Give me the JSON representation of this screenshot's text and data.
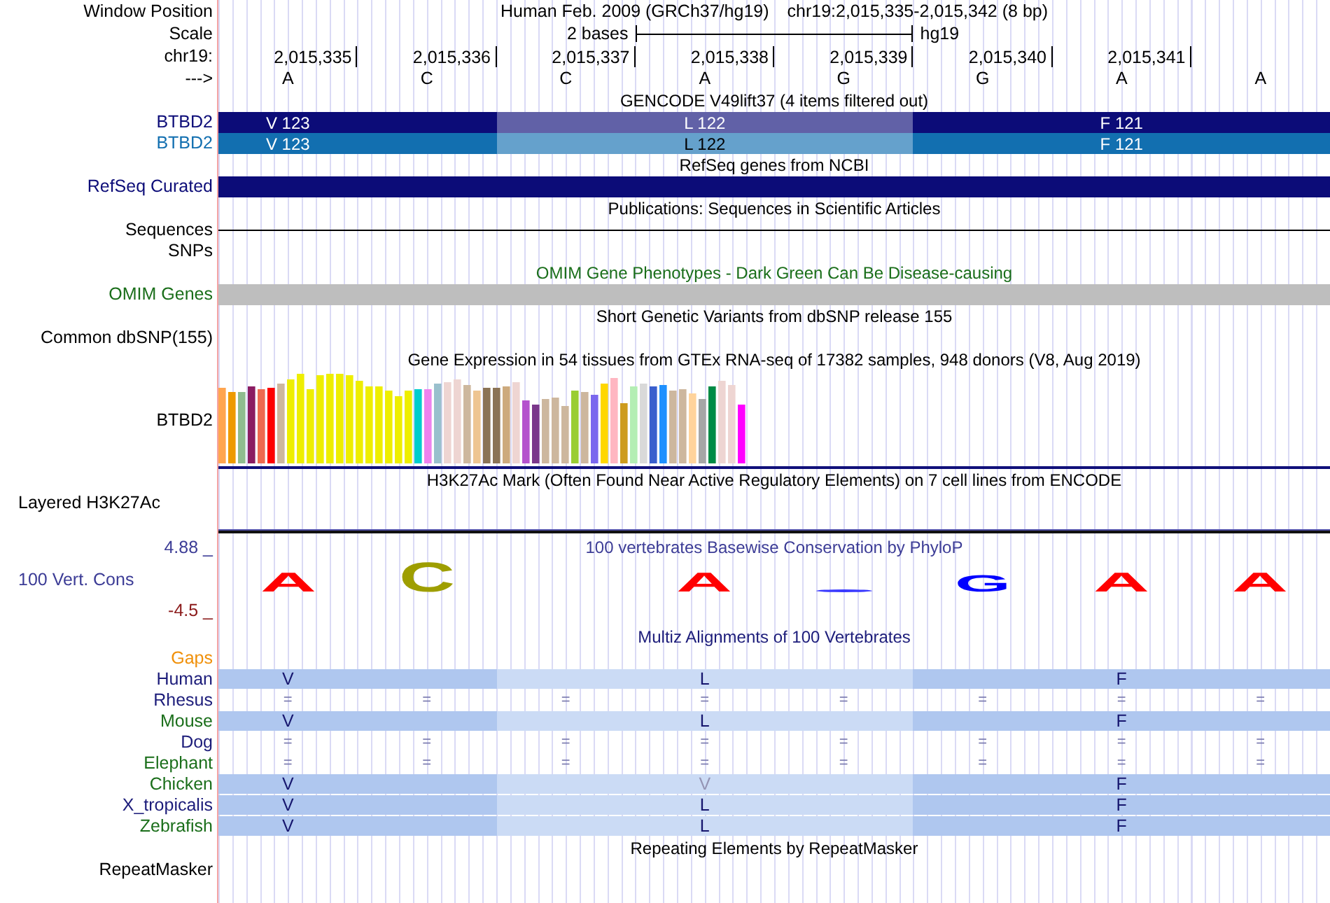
{
  "header": {
    "window_position": {
      "label": "Window Position",
      "assembly": "Human Feb. 2009 (GRCh37/hg19)",
      "range": "chr19:2,015,335-2,015,342 (8 bp)"
    },
    "scale": {
      "label": "Scale",
      "length": "2 bases",
      "assembly": "hg19"
    },
    "ruler": {
      "label": "chr19:",
      "ticks": [
        "2,015,335",
        "2,015,336",
        "2,015,337",
        "2,015,338",
        "2,015,339",
        "2,015,340",
        "2,015,341"
      ]
    },
    "strand": {
      "label": "--->",
      "bases": [
        "A",
        "C",
        "C",
        "A",
        "G",
        "G",
        "A",
        "A"
      ]
    }
  },
  "tracks": [
    {
      "title": {
        "text": "GENCODE V49lift37 (4 items filtered out)"
      },
      "rows": [
        {
          "kind": "codons",
          "label": {
            "text": "BTBD2",
            "color": "#0c0c78"
          },
          "color": "#0c0c78",
          "codons": [
            "V 123",
            "L 122",
            "F 121"
          ]
        },
        {
          "kind": "codons",
          "label": {
            "text": "BTBD2",
            "color": "#126fb0"
          },
          "color": "#126fb0",
          "codons": [
            "V 123",
            "L 122",
            "F 121"
          ]
        }
      ]
    },
    {
      "title": {
        "text": "RefSeq genes from NCBI"
      },
      "rows": [
        {
          "kind": "solid",
          "label": {
            "text": "RefSeq Curated",
            "color": "#0c0c78"
          },
          "color": "#0c0c78"
        }
      ]
    },
    {
      "title": {
        "text": "Publications: Sequences in Scientific Articles"
      },
      "rows": [
        {
          "kind": "line",
          "label": {
            "text": "Sequences"
          }
        },
        {
          "kind": "empty",
          "label": {
            "text": "SNPs"
          }
        }
      ]
    },
    {
      "title": {
        "text": "OMIM Gene Phenotypes - Dark Green Can Be Disease-causing",
        "color": "#1a6e1a"
      },
      "rows": [
        {
          "kind": "solid",
          "label": {
            "text": "OMIM Genes",
            "color": "#1a6e1a"
          },
          "color": "#bebebe"
        }
      ]
    },
    {
      "title": {
        "text": "Short Genetic Variants from dbSNP release 155"
      },
      "rows": [
        {
          "kind": "empty",
          "label": {
            "text": "Common dbSNP(155)"
          }
        }
      ]
    },
    {
      "title": {
        "text": "Gene Expression in 54 tissues from GTEx RNA-seq of 17382 samples, 948 donors (V8, Aug 2019)"
      },
      "rows": [
        {
          "kind": "expression",
          "label": {
            "text": "BTBD2"
          }
        }
      ]
    },
    {
      "title": {
        "text": "H3K27Ac Mark (Often Found Near Active Regulatory Elements) on 7 cell lines from ENCODE"
      },
      "rows": [
        {
          "kind": "signal",
          "label": {
            "text": "Layered H3K27Ac"
          }
        }
      ]
    },
    {
      "rows": [
        {
          "kind": "conservation",
          "title": {
            "text": "100 vertebrates Basewise Conservation by PhyloP",
            "color": "#3c3c96"
          },
          "label": {
            "text": "100 Vert. Cons",
            "color": "#3c3c96"
          },
          "ymax": "4.88 _",
          "ymin": "-4.5 _",
          "logo": [
            {
              "kind": "letter",
              "letter": "A",
              "color": "#ff0000"
            },
            {
              "kind": "letter",
              "letter": "C",
              "color": "#9e9e00"
            },
            {
              "kind": "blank"
            },
            {
              "kind": "letter",
              "letter": "A",
              "color": "#ff0000"
            },
            {
              "kind": "flat",
              "color": "#3a3aff"
            },
            {
              "kind": "letter",
              "letter": "G",
              "color": "#0000ff"
            },
            {
              "kind": "letter",
              "letter": "A",
              "color": "#ff0000"
            },
            {
              "kind": "letter",
              "letter": "A",
              "color": "#ff0000"
            }
          ]
        }
      ]
    },
    {
      "title": {
        "text": "Multiz Alignments of 100 Vertebrates",
        "color": "#1c1c7a"
      },
      "rows": [
        {
          "kind": "empty",
          "label": {
            "text": "Gaps",
            "color": "#f0900a"
          }
        },
        {
          "kind": "alignment",
          "label": {
            "text": "Human",
            "color": "#1c1c7a"
          },
          "color": "#afc7ef",
          "codons": [
            {
              "residue": "V",
              "differs": false
            },
            {
              "residue": "L",
              "differs": false
            },
            {
              "residue": "F",
              "differs": false
            }
          ]
        },
        {
          "kind": "matches",
          "label": {
            "text": "Rhesus",
            "color": "#1c1c7a"
          },
          "marks": [
            "=",
            "=",
            "=",
            "=",
            "=",
            "=",
            "=",
            "="
          ]
        },
        {
          "kind": "alignment",
          "label": {
            "text": "Mouse",
            "color": "#1a6e1a"
          },
          "color": "#afc7ef",
          "codons": [
            {
              "residue": "V",
              "differs": false
            },
            {
              "residue": "L",
              "differs": false
            },
            {
              "residue": "F",
              "differs": false
            }
          ]
        },
        {
          "kind": "matches",
          "label": {
            "text": "Dog",
            "color": "#1c1c7a"
          },
          "marks": [
            "=",
            "=",
            "=",
            "=",
            "=",
            "=",
            "=",
            "="
          ]
        },
        {
          "kind": "matches",
          "label": {
            "text": "Elephant",
            "color": "#1a6e1a"
          },
          "marks": [
            "=",
            "=",
            "=",
            "=",
            "=",
            "=",
            "=",
            "="
          ]
        },
        {
          "kind": "alignment",
          "label": {
            "text": "Chicken",
            "color": "#1a6e1a"
          },
          "color": "#afc7ef",
          "codons": [
            {
              "residue": "V",
              "differs": false
            },
            {
              "residue": "V",
              "differs": true
            },
            {
              "residue": "F",
              "differs": false
            }
          ]
        },
        {
          "kind": "alignment",
          "label": {
            "text": "X_tropicalis",
            "color": "#1c1c7a"
          },
          "color": "#afc7ef",
          "codons": [
            {
              "residue": "V",
              "differs": false
            },
            {
              "residue": "L",
              "differs": false
            },
            {
              "residue": "F",
              "differs": false
            }
          ]
        },
        {
          "kind": "alignment",
          "label": {
            "text": "Zebrafish",
            "color": "#1a6e1a"
          },
          "color": "#afc7ef",
          "codons": [
            {
              "residue": "V",
              "differs": false
            },
            {
              "residue": "L",
              "differs": false
            },
            {
              "residue": "F",
              "differs": false
            }
          ]
        }
      ]
    },
    {
      "title": {
        "text": "Repeating Elements by RepeatMasker"
      },
      "rows": [
        {
          "kind": "empty",
          "label": {
            "text": "RepeatMasker"
          }
        }
      ]
    }
  ]
}
